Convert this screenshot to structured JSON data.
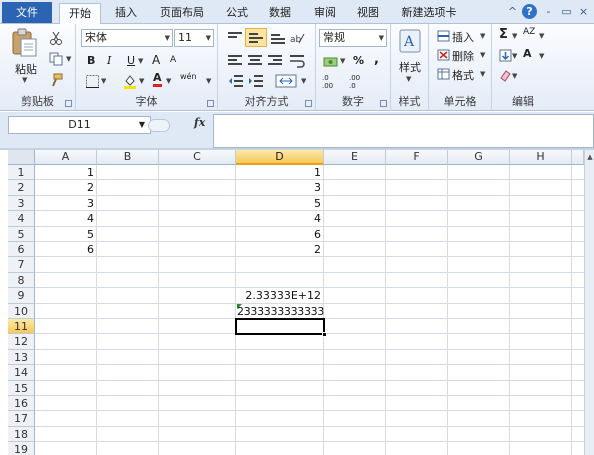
{
  "tabs": {
    "file": "文件",
    "items": [
      "开始",
      "插入",
      "页面布局",
      "公式",
      "数据",
      "审阅",
      "视图",
      "新建选项卡"
    ],
    "active": "开始"
  },
  "window_controls": {
    "collapse": "^",
    "help": "?",
    "minimize": "-",
    "restore": "▭",
    "close": "×"
  },
  "ribbon": {
    "clipboard": {
      "label": "剪贴板",
      "paste": "粘贴"
    },
    "font": {
      "label": "字体",
      "name": "宋体",
      "size": "11",
      "bold": "B",
      "italic": "I",
      "underline": "U",
      "grow": "A",
      "shrink": "A",
      "text_color_glyph": "A",
      "phonetic": "wén"
    },
    "alignment": {
      "label": "对齐方式"
    },
    "number": {
      "label": "数字",
      "format": "常规",
      "percent": "%",
      "comma": ",",
      "inc_dec": ".0 .00",
      "dec_dec": ".00 .0"
    },
    "styles": {
      "label": "样式",
      "button": "样式"
    },
    "cells": {
      "label": "单元格",
      "insert": "插入",
      "delete": "删除",
      "format": "格式"
    },
    "editing": {
      "label": "编辑",
      "sum": "Σ",
      "sort": "AZ",
      "find": "A"
    }
  },
  "formula_bar": {
    "name_box": "D11",
    "fx": "fx",
    "content": ""
  },
  "grid": {
    "columns": [
      "A",
      "B",
      "C",
      "D",
      "E",
      "F",
      "G",
      "H"
    ],
    "rows": [
      "1",
      "2",
      "3",
      "4",
      "5",
      "6",
      "7",
      "8",
      "9",
      "10",
      "11",
      "12",
      "13",
      "14",
      "15",
      "16",
      "17",
      "18",
      "19"
    ],
    "selected_column": "D",
    "selected_row": "11",
    "col_a": [
      "1",
      "2",
      "3",
      "4",
      "5",
      "6"
    ],
    "col_d": [
      "1",
      "3",
      "5",
      "4",
      "6",
      "2"
    ],
    "d9": "2.33333E+12",
    "d10": "2333333333333"
  },
  "colors": {
    "accent": "#2a64b3",
    "selection": "#f7c95a",
    "error_marker": "#1f8f1f"
  }
}
